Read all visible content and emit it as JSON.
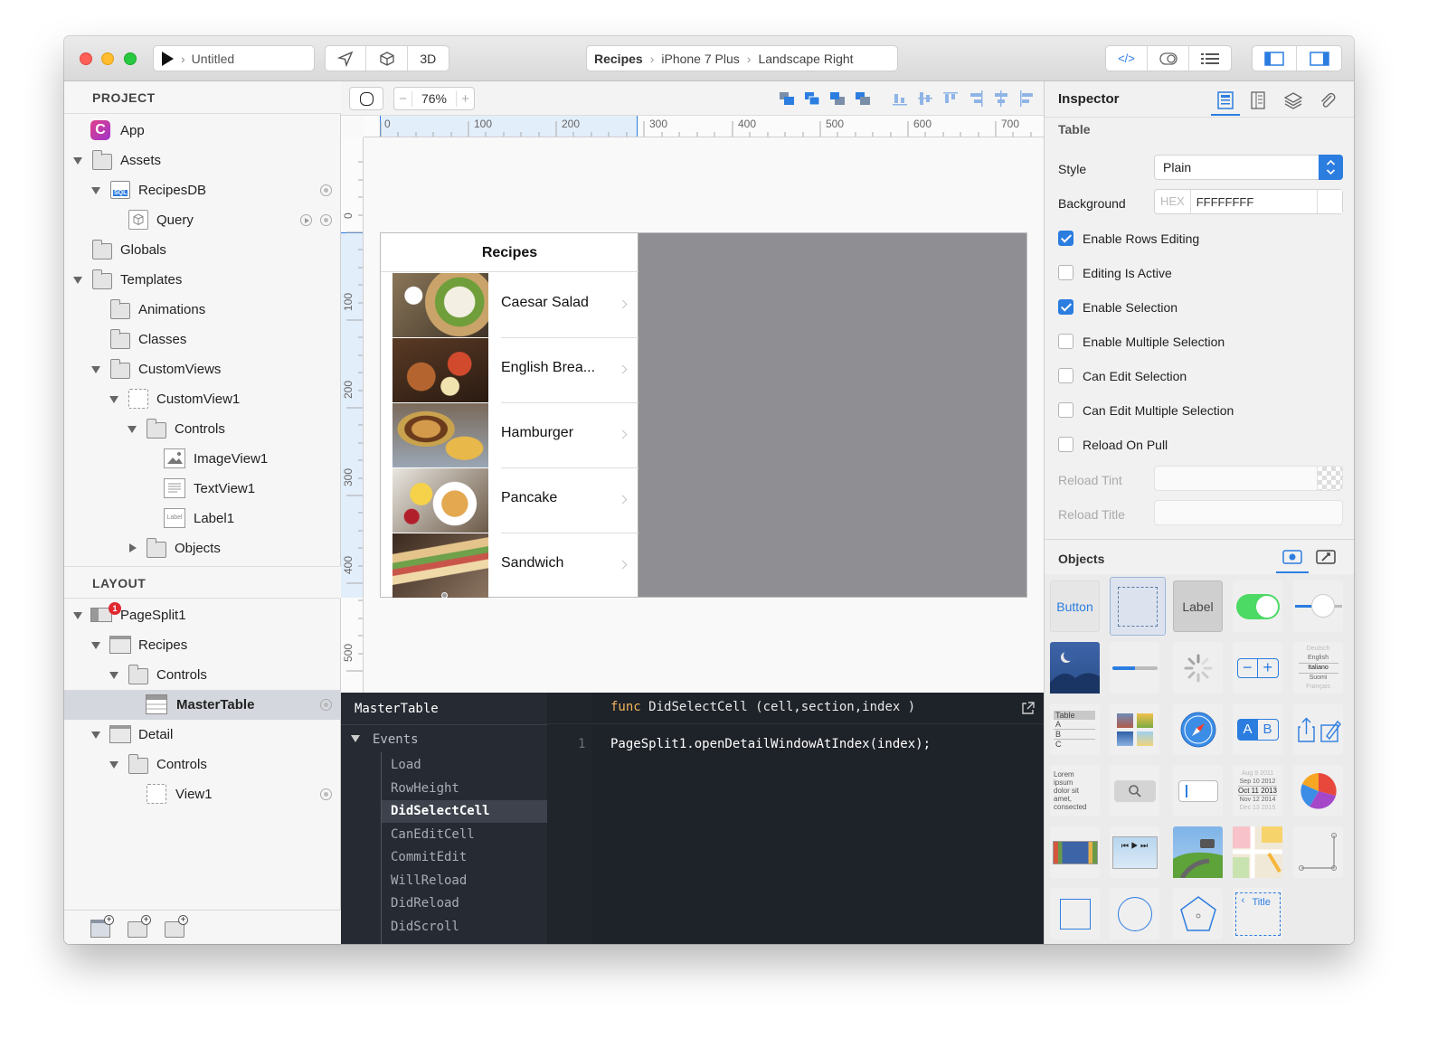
{
  "window": {
    "run_target": "Untitled",
    "view_3d_label": "3D",
    "breadcrumb": [
      "Recipes",
      "iPhone 7 Plus",
      "Landscape Right"
    ],
    "code_toggle_icon": "</>"
  },
  "project": {
    "header": "PROJECT",
    "items": [
      {
        "label": "App"
      },
      {
        "label": "Assets"
      },
      {
        "label": "RecipesDB"
      },
      {
        "label": "Query"
      },
      {
        "label": "Globals"
      },
      {
        "label": "Templates"
      },
      {
        "label": "Animations"
      },
      {
        "label": "Classes"
      },
      {
        "label": "CustomViews"
      },
      {
        "label": "CustomView1"
      },
      {
        "label": "Controls"
      },
      {
        "label": "ImageView1"
      },
      {
        "label": "TextView1"
      },
      {
        "label": "Label1"
      },
      {
        "label": "Objects"
      }
    ],
    "badges": {
      "sql": "SQL",
      "label_icon": "Label"
    }
  },
  "layout": {
    "header": "LAYOUT",
    "items": [
      {
        "label": "PageSplit1",
        "badge": "1"
      },
      {
        "label": "Recipes"
      },
      {
        "label": "Controls"
      },
      {
        "label": "MasterTable"
      },
      {
        "label": "Detail"
      },
      {
        "label": "Controls"
      },
      {
        "label": "View1"
      }
    ]
  },
  "canvas": {
    "zoom": "76%",
    "zoom_minus": "−",
    "zoom_plus": "+",
    "hruler": [
      "0",
      "100",
      "200",
      "300",
      "400",
      "500",
      "600",
      "700"
    ],
    "vruler": [
      "0",
      "100",
      "200",
      "300",
      "400",
      "500"
    ]
  },
  "device": {
    "table_title": "Recipes",
    "rows": [
      {
        "label": "Caesar Salad"
      },
      {
        "label": "English Brea..."
      },
      {
        "label": "Hamburger"
      },
      {
        "label": "Pancake"
      },
      {
        "label": "Sandwich"
      }
    ]
  },
  "code": {
    "object_name": "MasterTable",
    "events_header": "Events",
    "events": [
      "Load",
      "RowHeight",
      "DidSelectCell",
      "CanEditCell",
      "CommitEdit",
      "WillReload",
      "DidReload",
      "DidScroll"
    ],
    "selected_event": "DidSelectCell",
    "func_keyword": "func",
    "func_signature": "DidSelectCell  (cell,section,index )",
    "line_number": "1",
    "line_code": "PageSplit1.openDetailWindowAtIndex(index);"
  },
  "inspector": {
    "title": "Inspector",
    "section": "Table",
    "style_label": "Style",
    "style_value": "Plain",
    "background_label": "Background",
    "hex_label": "HEX",
    "hex_value": "FFFFFFFF",
    "checkboxes": [
      {
        "label": "Enable Rows Editing",
        "checked": true
      },
      {
        "label": "Editing Is Active",
        "checked": false
      },
      {
        "label": "Enable Selection",
        "checked": true
      },
      {
        "label": "Enable Multiple Selection",
        "checked": false
      },
      {
        "label": "Can Edit Selection",
        "checked": false
      },
      {
        "label": "Can Edit Multiple Selection",
        "checked": false
      },
      {
        "label": "Reload On Pull",
        "checked": false
      }
    ],
    "reload_tint_label": "Reload Tint",
    "reload_title_label": "Reload Title"
  },
  "objects": {
    "title": "Objects",
    "button_label": "Button",
    "label_label": "Label",
    "table_thumb": [
      "Table",
      "A",
      "B",
      "C"
    ],
    "picker_thumb": [
      "Deutsch",
      "English",
      "Italiano",
      "Suomi",
      "Français"
    ],
    "segment_thumb": [
      "A",
      "B"
    ],
    "textview_thumb": "Lorem ipsum dolor sit amet, consected",
    "date_thumb": [
      "Aug 9 2011",
      "Sep 10 2012",
      "Oct 11 2013",
      "Nov 12 2014",
      "Dec 13 2015"
    ],
    "nav_title": "Title"
  },
  "colors": {
    "accent": "#2c7de0",
    "code_bg": "#1e2229",
    "device_bg": "#8e8e93"
  }
}
